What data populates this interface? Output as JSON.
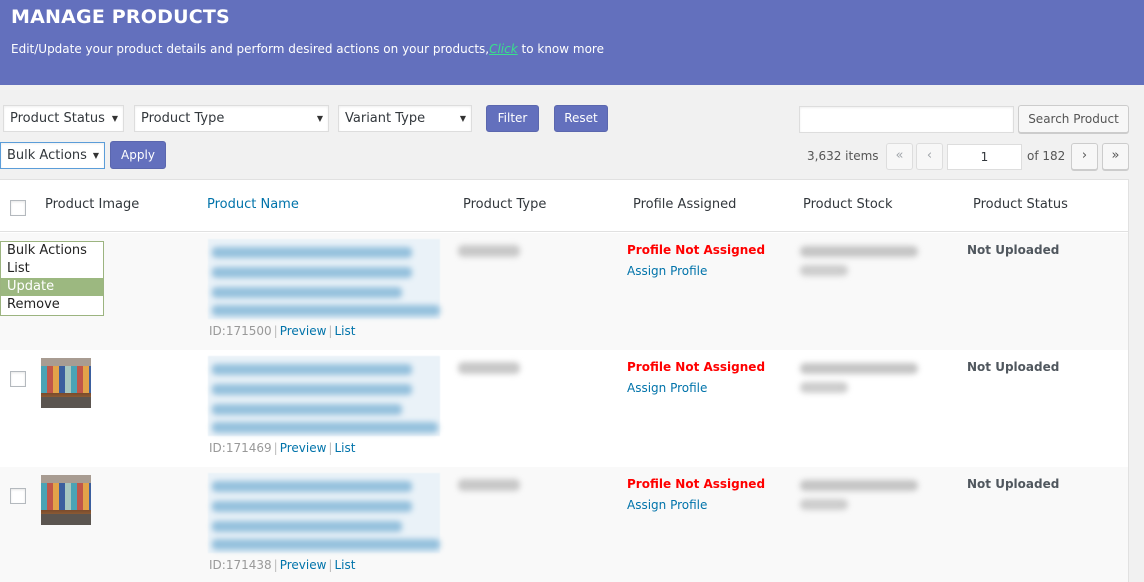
{
  "header": {
    "title": "MANAGE PRODUCTS",
    "subtitle_before": "Edit/Update your product details and perform desired actions on your products,",
    "subtitle_link": "Click",
    "subtitle_after": " to know more"
  },
  "filters": {
    "product_status": "Product Status",
    "product_type": "Product Type",
    "variant_type": "Variant Type",
    "filter_label": "Filter",
    "reset_label": "Reset"
  },
  "bulk": {
    "selected": "Bulk Actions",
    "apply_label": "Apply",
    "options": [
      "Bulk Actions",
      "List",
      "Update",
      "Remove"
    ],
    "highlighted": "Update"
  },
  "search": {
    "value": "",
    "button_label": "Search Product"
  },
  "pagination": {
    "items": "3,632 items",
    "first": "«",
    "prev": "‹",
    "current": "1",
    "of_total": "of 182",
    "next": "›",
    "last": "»"
  },
  "table": {
    "columns": [
      "Product Image",
      "Product Name",
      "Product Type",
      "Profile Assigned",
      "Product Stock",
      "Product Status"
    ],
    "rows": [
      {
        "id": "ID:171500",
        "preview": "Preview",
        "list": "List",
        "profile": "Profile Not Assigned",
        "assign": "Assign Profile",
        "status": "Not Uploaded"
      },
      {
        "id": "ID:171469",
        "preview": "Preview",
        "list": "List",
        "profile": "Profile Not Assigned",
        "assign": "Assign Profile",
        "status": "Not Uploaded"
      },
      {
        "id": "ID:171438",
        "preview": "Preview",
        "list": "List",
        "profile": "Profile Not Assigned",
        "assign": "Assign Profile",
        "status": "Not Uploaded"
      }
    ]
  },
  "colors": {
    "header_bg": "#6370bd",
    "link": "#0073aa",
    "error": "#ff0000",
    "highlight_link": "#39e08c",
    "dropdown_selected": "#9cb880"
  }
}
